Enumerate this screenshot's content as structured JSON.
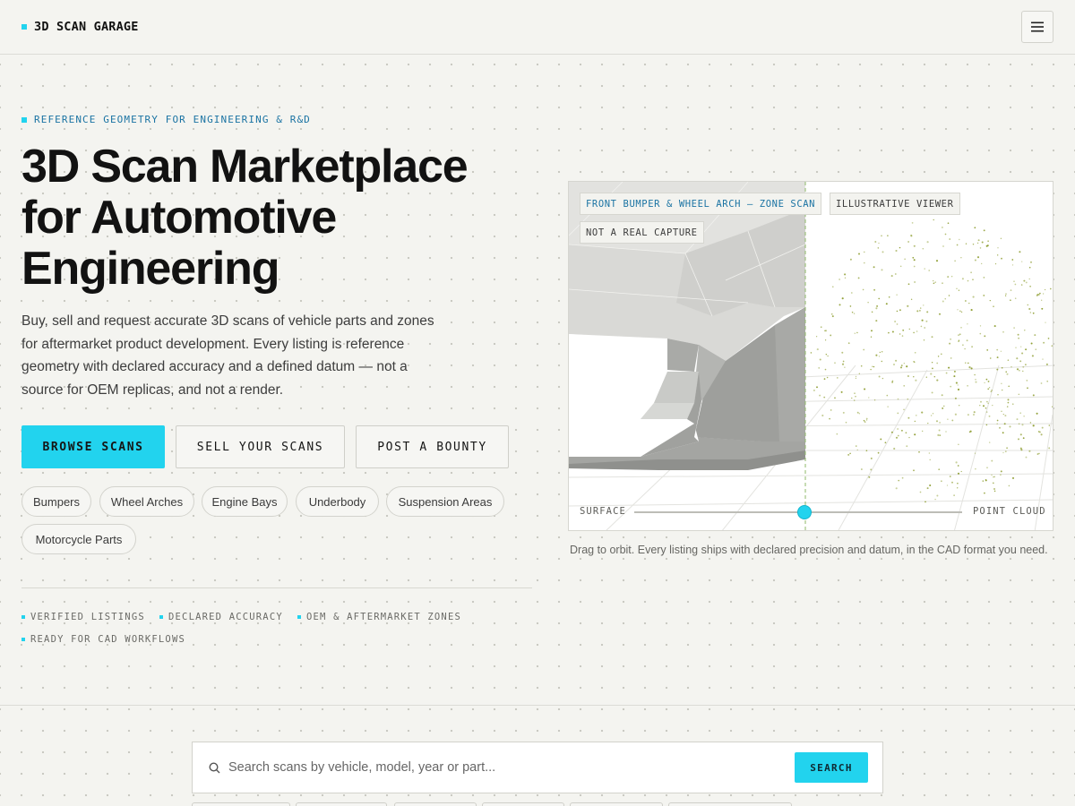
{
  "header": {
    "brand": "3D SCAN GARAGE",
    "menu_icon": "hamburger-menu-icon"
  },
  "hero": {
    "eyebrow": "REFERENCE GEOMETRY FOR ENGINEERING & R&D",
    "title_lines": [
      "3D Scan Marketplace",
      "for Automotive",
      "Engineering"
    ],
    "lead": "Buy, sell and request accurate 3D scans of vehicle parts and zones for aftermarket product development. Every listing is reference geometry with declared accuracy and a defined datum — not a source for OEM replicas, and not a render.",
    "buttons": {
      "browse": "BROWSE SCANS",
      "sell": "SELL YOUR SCANS",
      "bounty": "POST A BOUNTY"
    },
    "categories": [
      "Bumpers",
      "Wheel Arches",
      "Engine Bays",
      "Underbody",
      "Suspension Areas",
      "Motorcycle Parts"
    ],
    "features": [
      "VERIFIED LISTINGS",
      "DECLARED ACCURACY",
      "OEM & AFTERMARKET ZONES",
      "READY FOR CAD WORKFLOWS"
    ]
  },
  "viewer": {
    "labels": [
      "FRONT BUMPER & WHEEL ARCH — ZONE SCAN",
      "ILLUSTRATIVE VIEWER",
      "NOT A REAL CAPTURE"
    ],
    "slider": {
      "left_label": "SURFACE",
      "right_label": "POINT CLOUD",
      "value": 0.5
    },
    "caption": "Drag to orbit. Every listing ships with declared precision and datum, in the CAD format you need."
  },
  "search": {
    "placeholder": "Search scans by vehicle, model, year or part...",
    "value": "",
    "button": "SEARCH",
    "icon": "search-icon"
  },
  "colors": {
    "accent": "#22d3ee",
    "accent_text": "#1a73a3",
    "background": "#f4f4f0",
    "point_cloud": "#8a9a2a"
  }
}
